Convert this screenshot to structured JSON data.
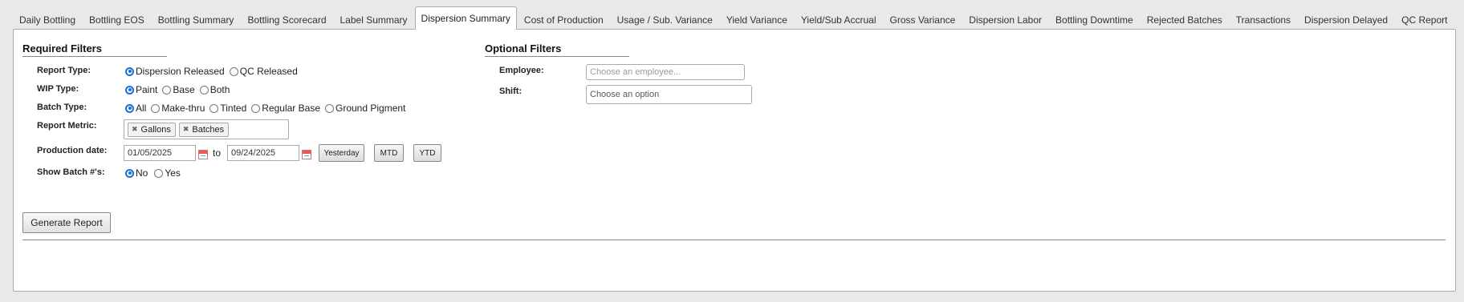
{
  "tabs": [
    {
      "label": "Daily Bottling"
    },
    {
      "label": "Bottling EOS"
    },
    {
      "label": "Bottling Summary"
    },
    {
      "label": "Bottling Scorecard"
    },
    {
      "label": "Label Summary"
    },
    {
      "label": "Dispersion Summary",
      "active": true
    },
    {
      "label": "Cost of Production"
    },
    {
      "label": "Usage / Sub. Variance"
    },
    {
      "label": "Yield Variance"
    },
    {
      "label": "Yield/Sub Accrual"
    },
    {
      "label": "Gross Variance"
    },
    {
      "label": "Dispersion Labor"
    },
    {
      "label": "Bottling Downtime"
    },
    {
      "label": "Rejected Batches"
    },
    {
      "label": "Transactions"
    },
    {
      "label": "Dispersion Delayed"
    },
    {
      "label": "QC Report"
    }
  ],
  "required": {
    "title": "Required Filters",
    "report_type": {
      "label": "Report Type:",
      "options": [
        "Dispersion Released",
        "QC Released"
      ],
      "selected": "Dispersion Released"
    },
    "wip_type": {
      "label": "WIP Type:",
      "options": [
        "Paint",
        "Base",
        "Both"
      ],
      "selected": "Paint"
    },
    "batch_type": {
      "label": "Batch Type:",
      "options": [
        "All",
        "Make-thru",
        "Tinted",
        "Regular Base",
        "Ground Pigment"
      ],
      "selected": "All"
    },
    "report_metric": {
      "label": "Report Metric:",
      "chips": [
        "Gallons",
        "Batches"
      ]
    },
    "production_date": {
      "label": "Production date:",
      "from": "01/05/2025",
      "to_label": "to",
      "to": "09/24/2025",
      "buttons": [
        "Yesterday",
        "MTD",
        "YTD"
      ]
    },
    "show_batch": {
      "label": "Show Batch #'s:",
      "options": [
        "No",
        "Yes"
      ],
      "selected": "No"
    }
  },
  "optional": {
    "title": "Optional Filters",
    "employee": {
      "label": "Employee:",
      "placeholder": "Choose an employee..."
    },
    "shift": {
      "label": "Shift:",
      "placeholder": "Choose an option"
    }
  },
  "generate_label": "Generate Report",
  "icons": {
    "calendar": "calendar-icon",
    "chip_remove": "close-icon"
  },
  "colors": {
    "radio_selected": "#1a6fd9",
    "page_bg": "#e9e9ec"
  }
}
